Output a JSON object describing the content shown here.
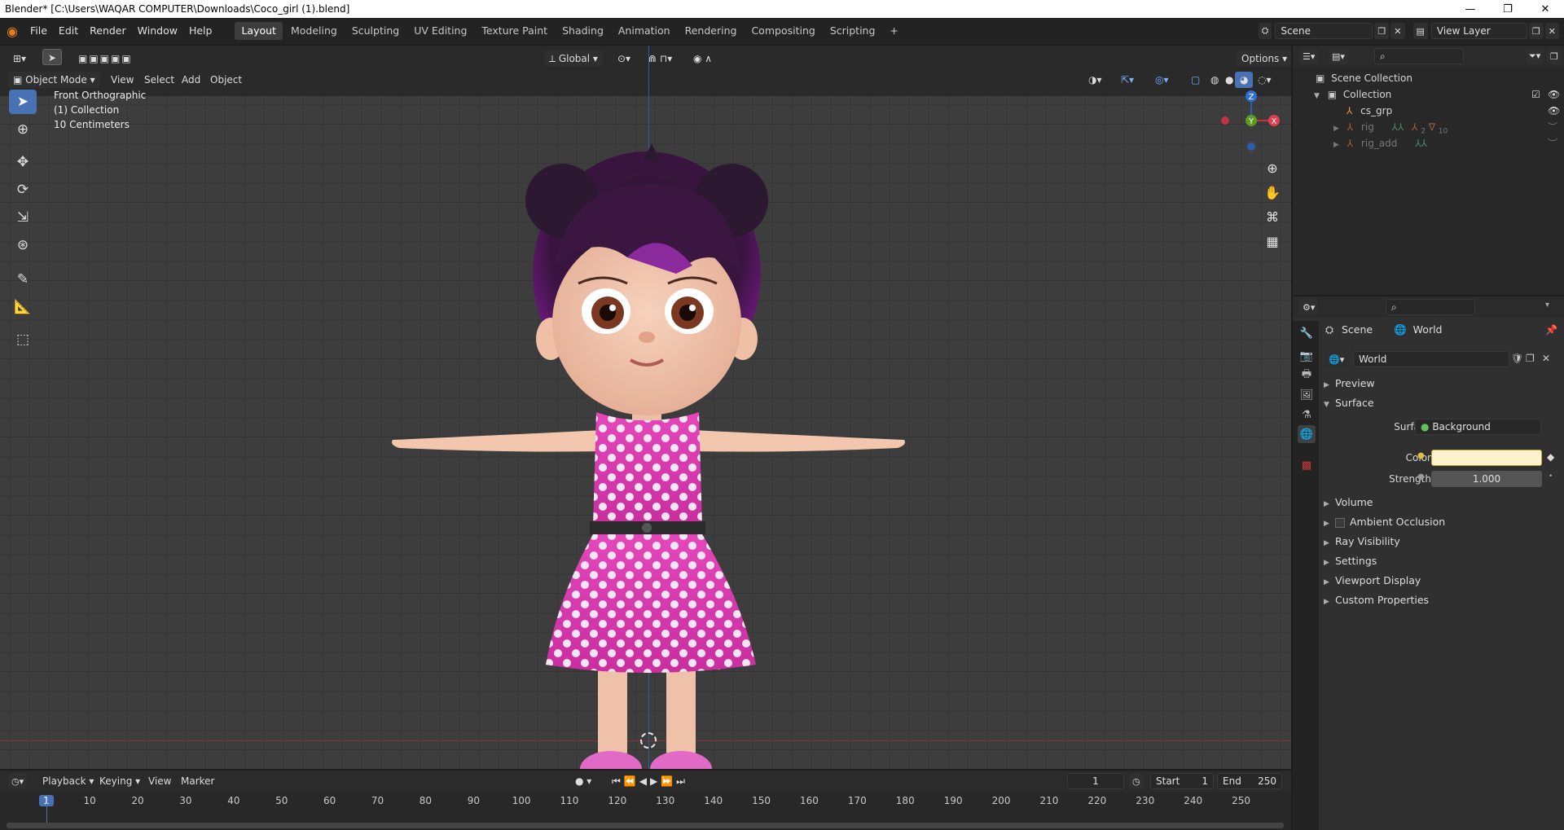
{
  "window": {
    "title": "Blender* [C:\\Users\\WAQAR COMPUTER\\Downloads\\Coco_girl (1).blend]",
    "minimize": "—",
    "maximize": "❐",
    "close": "✕"
  },
  "menu": {
    "items": [
      "File",
      "Edit",
      "Render",
      "Window",
      "Help"
    ]
  },
  "workspaces": {
    "tabs": [
      "Layout",
      "Modeling",
      "Sculpting",
      "UV Editing",
      "Texture Paint",
      "Shading",
      "Animation",
      "Rendering",
      "Compositing",
      "Scripting"
    ],
    "active": "Layout",
    "add": "+"
  },
  "scene": {
    "name": "Scene",
    "view_layer": "View Layer"
  },
  "viewport_header": {
    "mode": "Object Mode",
    "menus": [
      "View",
      "Select",
      "Add",
      "Object"
    ],
    "orientation": "Global",
    "options": "Options"
  },
  "viewport": {
    "view_name": "Front Orthographic",
    "collection": "(1) Collection",
    "scale": "10 Centimeters",
    "gizmo": {
      "z": "Z",
      "y": "Y",
      "x": "X"
    }
  },
  "outliner": {
    "rows": [
      {
        "label": "Scene Collection"
      },
      {
        "label": "Collection"
      },
      {
        "label": "cs_grp"
      },
      {
        "label": "rig",
        "badge": "2",
        "badge2": "10"
      },
      {
        "label": "rig_add"
      }
    ]
  },
  "properties": {
    "breadcrumb": {
      "scene": "Scene",
      "world": "World"
    },
    "world_name": "World",
    "panels": {
      "preview": "Preview",
      "surface": "Surface",
      "volume": "Volume",
      "ambient_occlusion": "Ambient Occlusion",
      "ray_visibility": "Ray Visibility",
      "settings": "Settings",
      "viewport_display": "Viewport Display",
      "custom_properties": "Custom Properties"
    },
    "surface_label": "Surface",
    "surface_value": "Background",
    "color_label": "Color",
    "color_value": "#fef2cf",
    "strength_label": "Strength",
    "strength_value": "1.000"
  },
  "timeline": {
    "menus": [
      "Playback",
      "Keying",
      "View",
      "Marker"
    ],
    "current_frame": "1",
    "start_label": "Start",
    "start": "1",
    "end_label": "End",
    "end": "250",
    "ticks": [
      "1",
      "10",
      "20",
      "30",
      "40",
      "50",
      "60",
      "70",
      "80",
      "90",
      "100",
      "110",
      "120",
      "130",
      "140",
      "150",
      "160",
      "170",
      "180",
      "190",
      "200",
      "210",
      "220",
      "230",
      "240",
      "250"
    ]
  },
  "colors": {
    "accent": "#4772b3",
    "active_frame": "#4772b3",
    "hair": "#7a1a8c",
    "dress": "#e23fb5",
    "skin": "#f3c7ad"
  }
}
